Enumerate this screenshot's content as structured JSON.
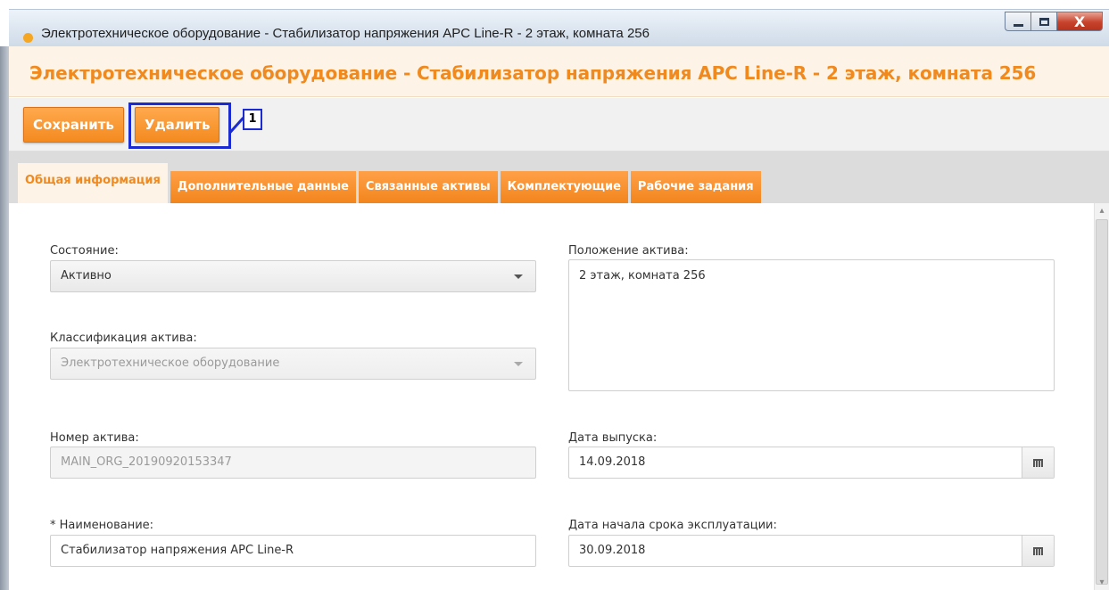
{
  "window": {
    "title": "Электротехническое оборудование - Стабилизатор напряжения APC Line-R - 2 этаж, комната 256",
    "close_glyph": "X"
  },
  "page": {
    "heading": "Электротехническое оборудование - Стабилизатор напряжения APC Line-R - 2 этаж, комната 256"
  },
  "toolbar": {
    "save_label": "Сохранить",
    "delete_label": "Удалить",
    "callout_number": "1"
  },
  "tabs": [
    {
      "label": "Общая информация",
      "active": true
    },
    {
      "label": "Дополнительные данные",
      "active": false
    },
    {
      "label": "Связанные активы",
      "active": false
    },
    {
      "label": "Комплектующие",
      "active": false
    },
    {
      "label": "Рабочие задания",
      "active": false
    }
  ],
  "form": {
    "state": {
      "label": "Состояние:",
      "value": "Активно"
    },
    "classification": {
      "label": "Классификация актива:",
      "value": "Электротехническое оборудование"
    },
    "asset_number": {
      "label": "Номер актива:",
      "value": "MAIN_ORG_20190920153347"
    },
    "name": {
      "label": "* Наименование:",
      "value": "Стабилизатор напряжения APC Line-R"
    },
    "location": {
      "label": "Положение актива:",
      "value": "2 этаж, комната 256"
    },
    "release_date": {
      "label": "Дата выпуска:",
      "value": "14.09.2018"
    },
    "service_start_date": {
      "label": "Дата начала срока эксплуатации:",
      "value": "30.09.2018"
    }
  },
  "colors": {
    "accent": "#f48a1f",
    "heading": "#f08a1e",
    "callout": "#1a2bd1"
  },
  "icons": {
    "window_dot": "status-dot-icon",
    "dropdown": "chevron-down-icon",
    "calendar": "calendar-icon"
  }
}
